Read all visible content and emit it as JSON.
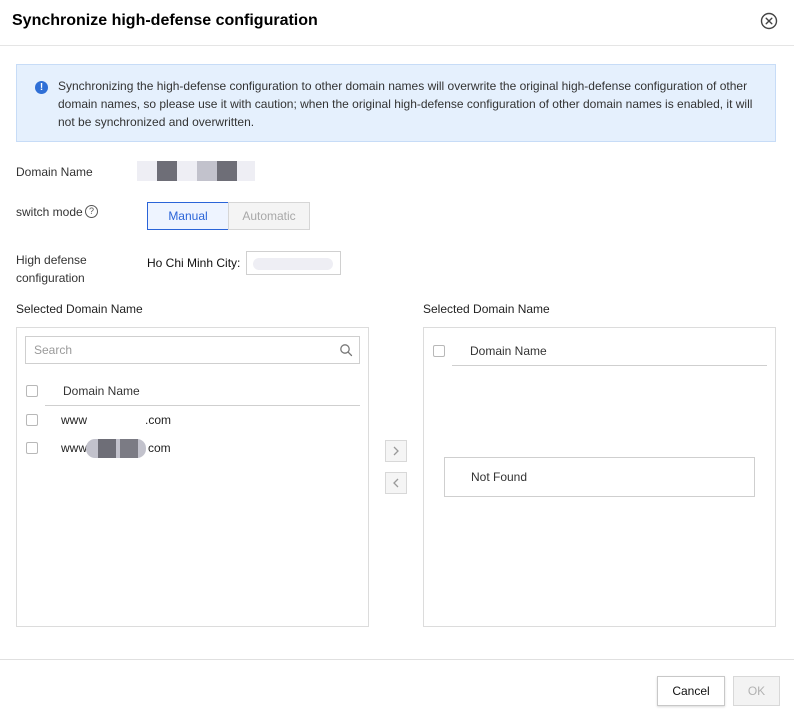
{
  "dialog": {
    "title": "Synchronize high-defense configuration",
    "close_icon": "close-circle-icon"
  },
  "notice": {
    "icon": "info-icon",
    "text": "Synchronizing the high-defense configuration to other domain names will overwrite the original high-defense configuration of other domain names, so please use it with caution; when the original high-defense configuration of other domain names is enabled, it will not be synchronized and overwritten."
  },
  "form": {
    "domain_name_label": "Domain Name",
    "switch_mode_label": "switch mode",
    "switch_mode_help_icon": "question-circle-icon",
    "modes": [
      "Manual",
      "Automatic"
    ],
    "selected_mode": "Manual",
    "high_defense_label_line1": "High defense",
    "high_defense_label_line2": "configuration",
    "city_label": "Ho Chi Minh City:"
  },
  "left_panel": {
    "title": "Selected Domain Name",
    "search_placeholder": "Search",
    "search_icon": "search-icon",
    "column_header": "Domain Name",
    "rows": [
      {
        "prefix": "www",
        "suffix": ".com"
      },
      {
        "prefix": "www",
        "suffix": "com"
      }
    ]
  },
  "transfer": {
    "move_right_icon": "chevron-right-icon",
    "move_left_icon": "chevron-left-icon"
  },
  "right_panel": {
    "title": "Selected Domain Name",
    "column_header": "Domain Name",
    "empty_text": "Not Found"
  },
  "footer": {
    "cancel_label": "Cancel",
    "ok_label": "OK"
  },
  "colors": {
    "accent": "#2a64d8",
    "notice_bg": "#e5f0fd",
    "info_icon": "#2f6fd6"
  }
}
